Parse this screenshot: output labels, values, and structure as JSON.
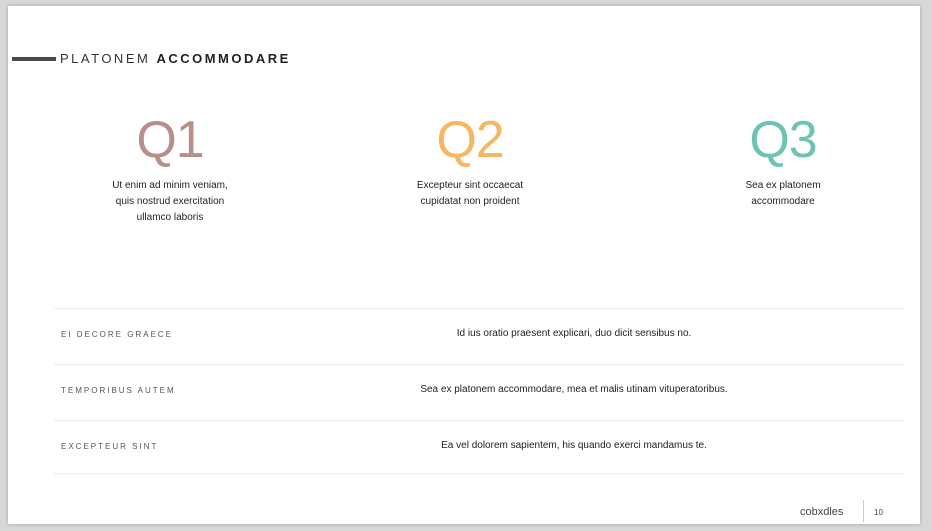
{
  "header": {
    "prefix": "PLATONEM",
    "bold": "ACCOMMODARE"
  },
  "quarters": [
    {
      "label": "Q1",
      "color": "#b78f8a",
      "lines": [
        "Ut enim ad minim veniam,",
        "quis nostrud exercitation",
        "ullamco laboris"
      ]
    },
    {
      "label": "Q2",
      "color": "#f4b860",
      "lines": [
        "Excepteur sint occaecat",
        "cupidatat non proident"
      ]
    },
    {
      "label": "Q3",
      "color": "#6cc4b2",
      "lines": [
        "Sea ex platonem",
        "accommodare"
      ]
    }
  ],
  "table": {
    "rows": [
      {
        "label": "EI DECORE GRAECE",
        "text": "Id ius oratio praesent explicari, duo dicit sensibus no."
      },
      {
        "label": "TEMPORIBUS AUTEM",
        "text": "Sea ex platonem accommodare, mea et malis utinam vituperatoribus."
      },
      {
        "label": "EXCEPTEUR SINT",
        "text": "Ea vel dolorem sapientem, his quando exerci mandamus te."
      }
    ]
  },
  "footer": {
    "brand": "cobxdles",
    "page": "10"
  }
}
